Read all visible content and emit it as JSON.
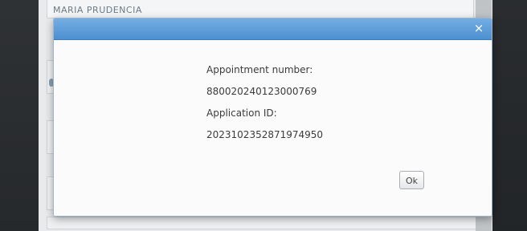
{
  "background": {
    "name_text": "MARIA PRUDENCIA"
  },
  "dialog": {
    "close_glyph": "×",
    "lines": [
      "Appointment number:",
      "880020240123000769",
      "Application ID:",
      "2023102352871974950"
    ],
    "ok_label": "Ok"
  },
  "colors": {
    "titlebar_top": "#74aee3",
    "titlebar_bottom": "#4d8fd0"
  }
}
